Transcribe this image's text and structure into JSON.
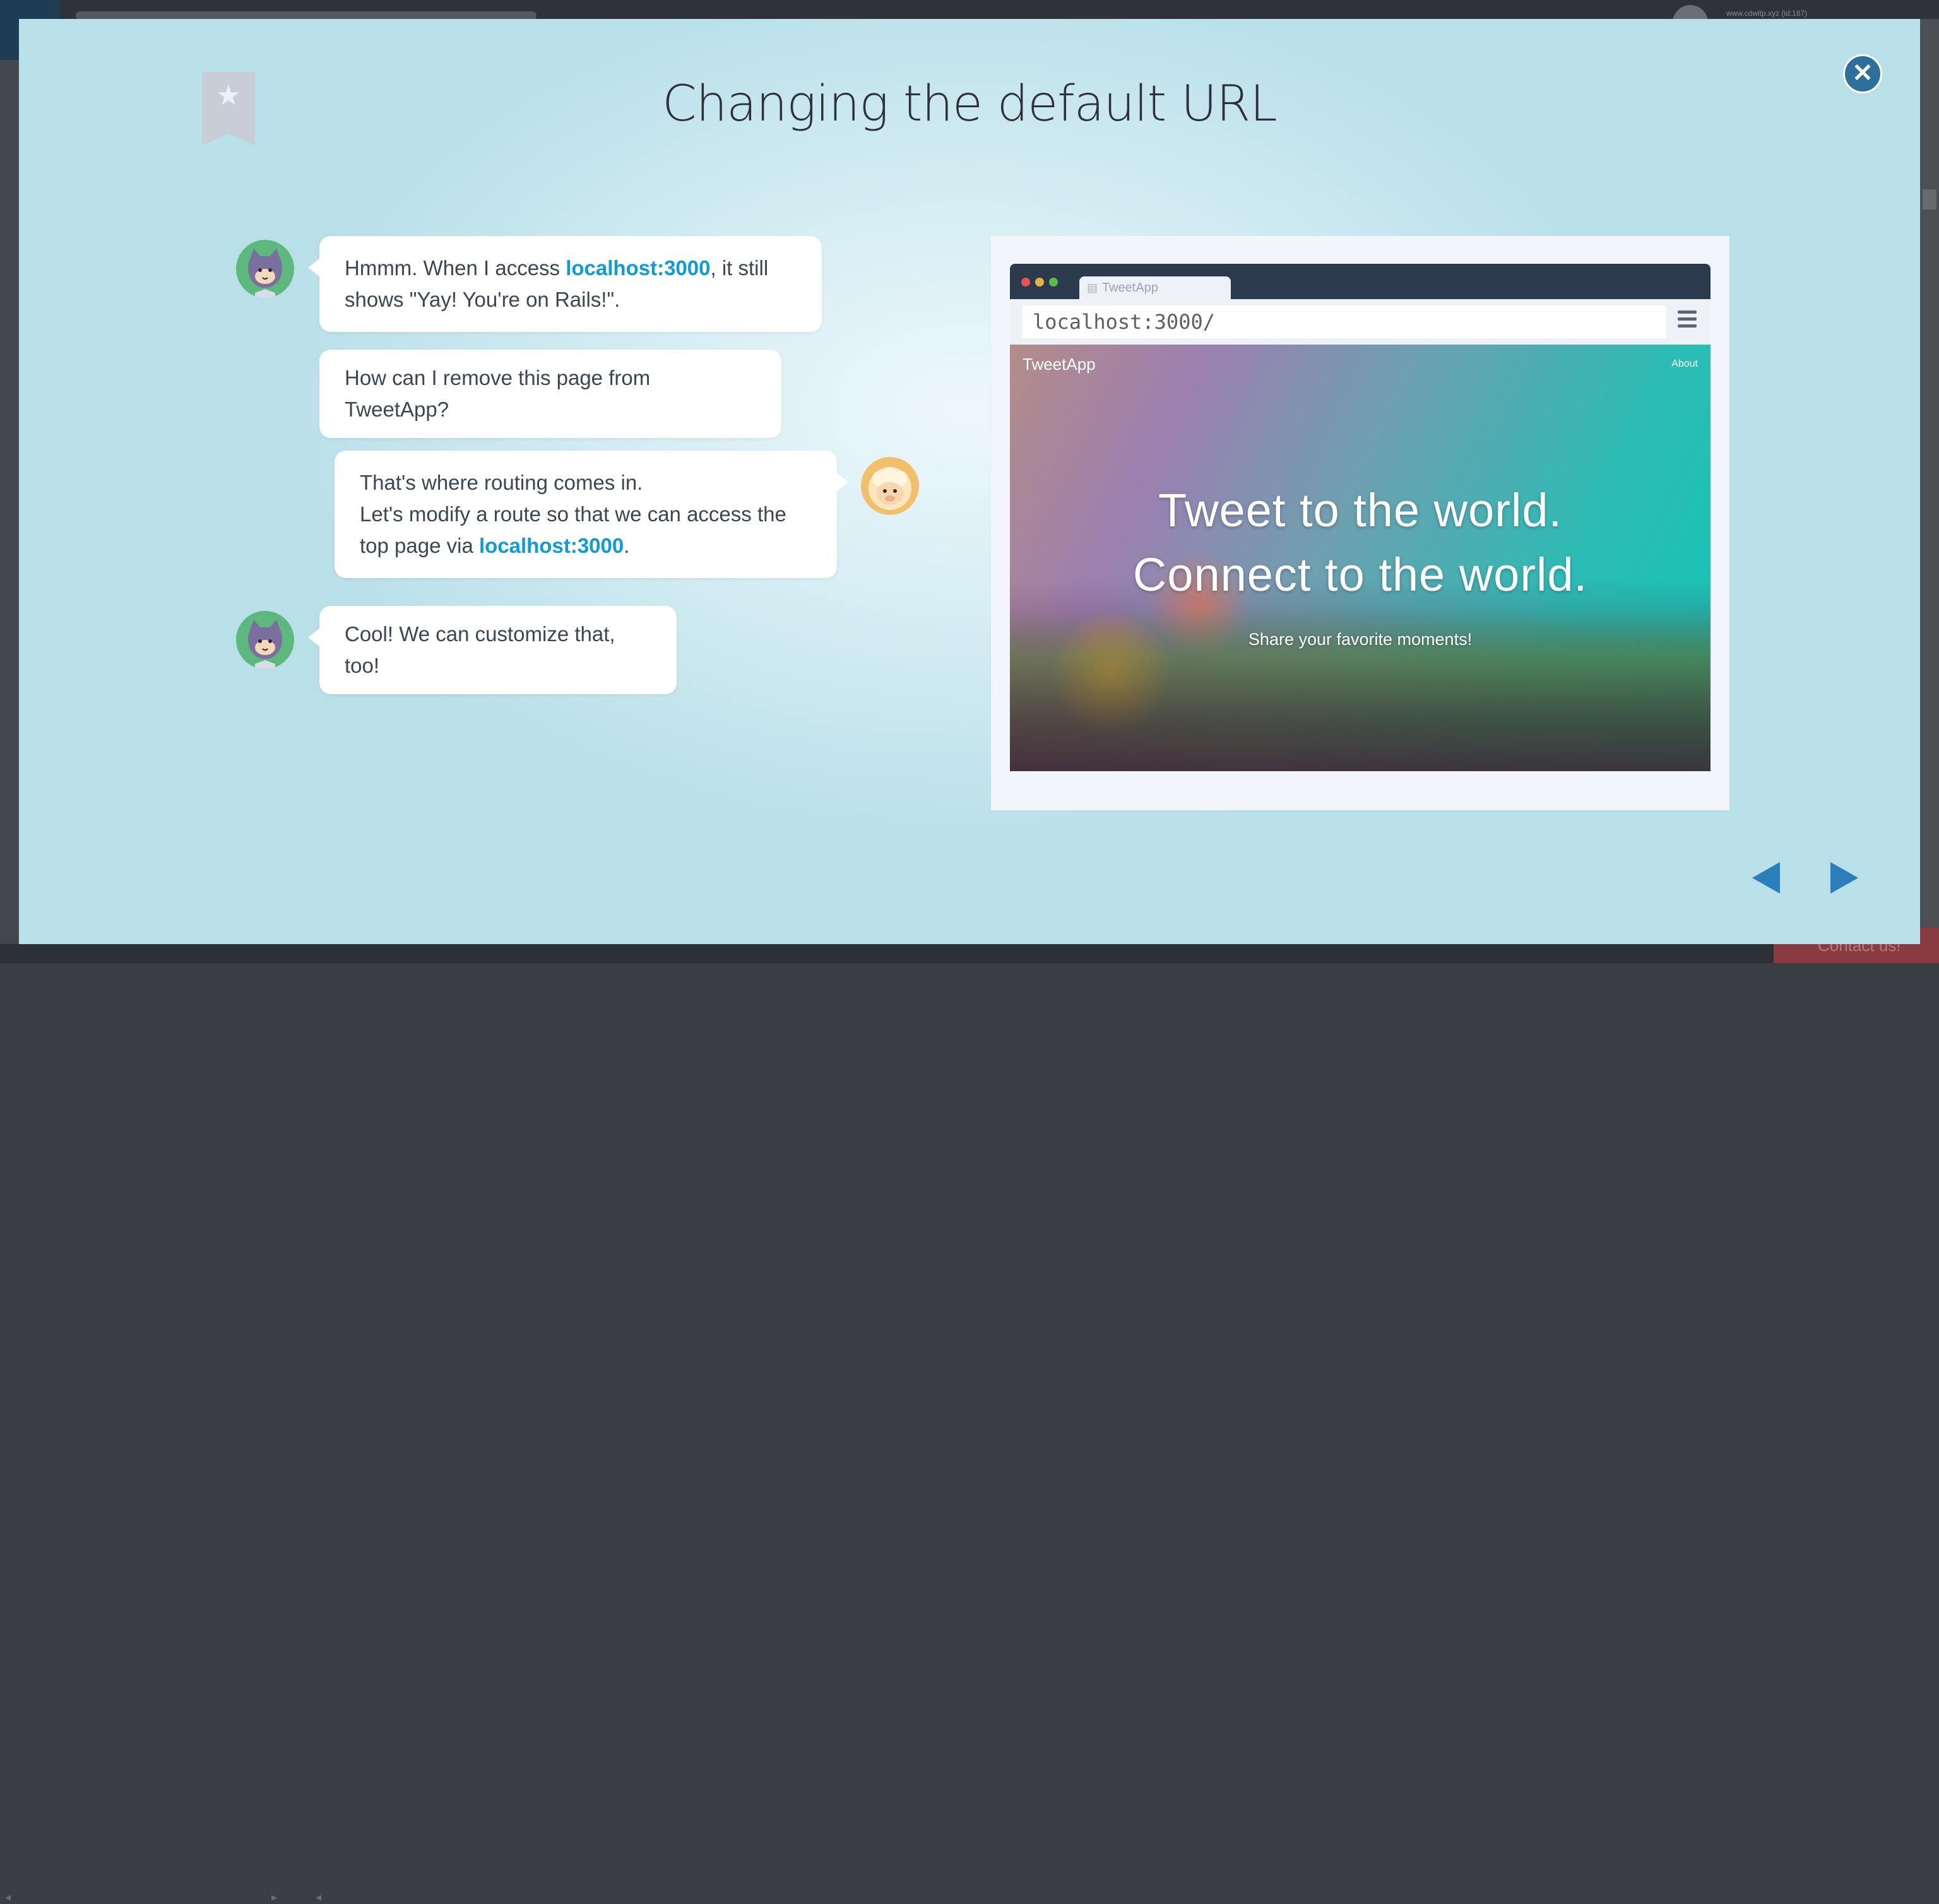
{
  "background": {
    "user_text": "www.cdwitp.xyz (id:187)",
    "contact_label": "Contact us!"
  },
  "modal": {
    "title": "Changing the default URL",
    "close_icon": "close-icon",
    "bookmark_icon": "star-icon"
  },
  "chat": {
    "m1": {
      "pre": "Hmmm. When I access ",
      "highlight": "localhost:3000",
      "post": ", it still shows \"Yay! You're on Rails!\"."
    },
    "m2": "How can I remove this page from TweetApp?",
    "m3": {
      "line1": "That's where routing comes in.",
      "line2": "Let's modify a route so that we can access the top page via ",
      "highlight": "localhost:3000",
      "post": "."
    },
    "m4": "Cool! We can customize that, too!"
  },
  "browser": {
    "tab_title": "TweetApp",
    "url": "localhost:3000/",
    "site_logo": "TweetApp",
    "site_nav_about": "About",
    "hero_line1": "Tweet to the world.",
    "hero_line2": "Connect to the world.",
    "hero_sub": "Share your favorite moments!"
  },
  "nav": {
    "prev_icon": "triangle-left-icon",
    "next_icon": "triangle-right-icon"
  },
  "colors": {
    "accent": "#0e9bd8",
    "nav_arrow": "#2a7fba",
    "close_button": "#2c6f9a"
  }
}
